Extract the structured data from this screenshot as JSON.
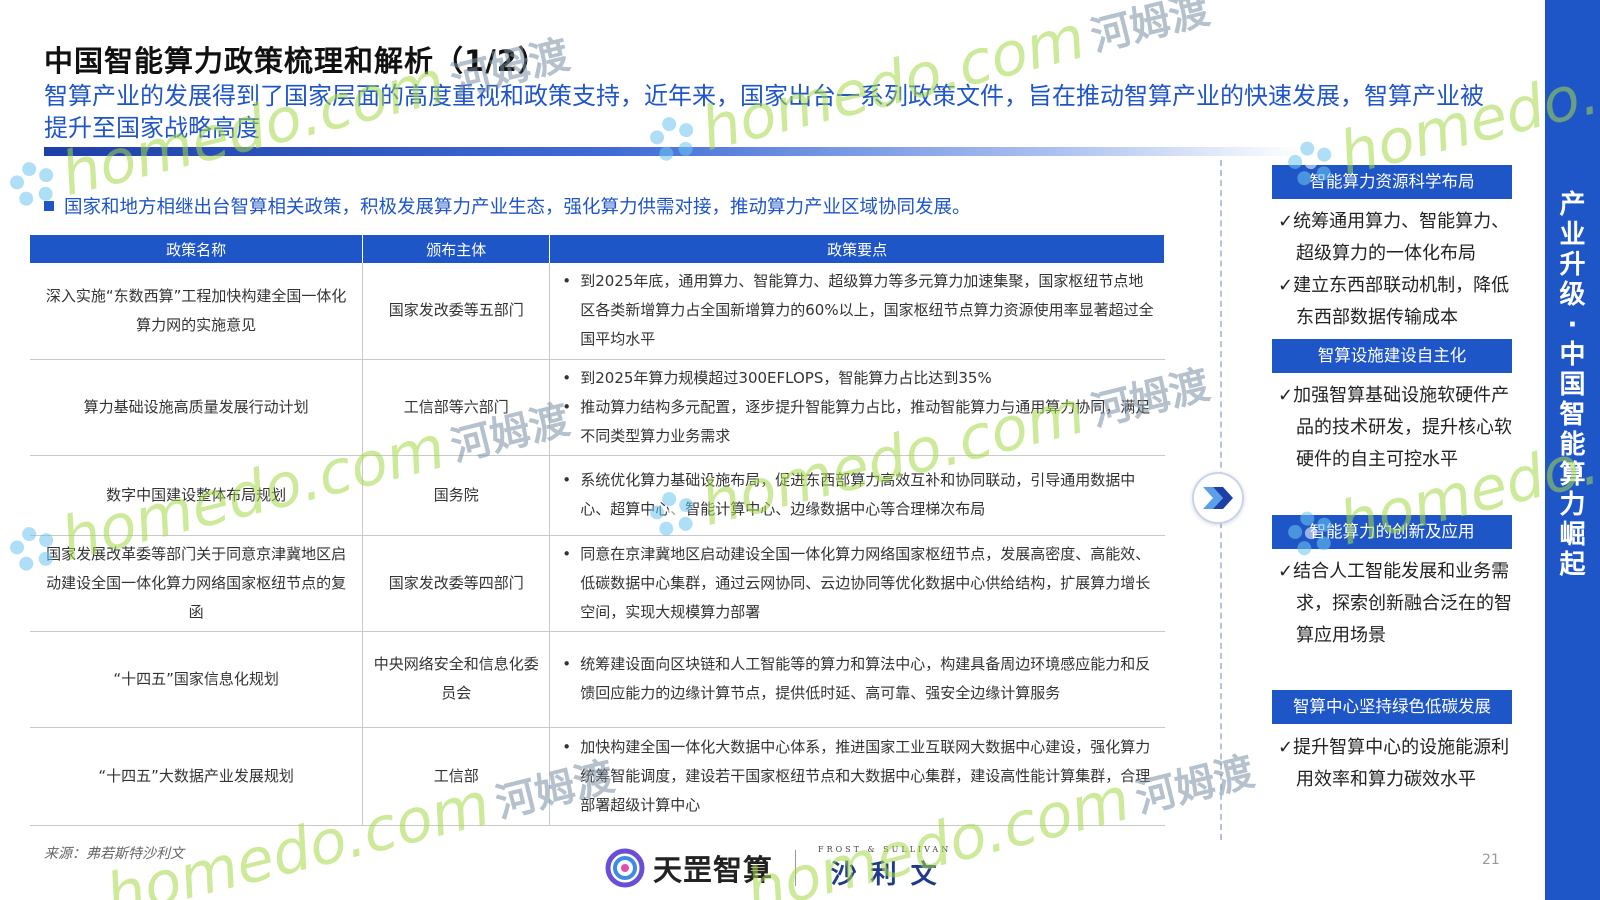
{
  "header": {
    "title": "中国智能算力政策梳理和解析（1/2）",
    "subtitle": "智算产业的发展得到了国家层面的高度重视和政策支持，近年来，国家出台一系列政策文件，旨在推动智算产业的快速发展，智算产业被提升至国家战略高度"
  },
  "intro": "国家和地方相继出台智算相关政策，积极发展算力产业生态，强化算力供需对接，推动算力产业区域协同发展。",
  "table": {
    "headers": [
      "政策名称",
      "颁布主体",
      "政策要点"
    ],
    "rows": [
      {
        "name": "深入实施“东数西算”工程加快构建全国一体化算力网的实施意见",
        "org": "国家发改委等五部门",
        "points": [
          "到2025年底，通用算力、智能算力、超级算力等多元算力加速集聚，国家枢纽节点地区各类新增算力占全国新增算力的60%以上，国家枢纽节点算力资源使用率显著超过全国平均水平"
        ]
      },
      {
        "name": "算力基础设施高质量发展行动计划",
        "org": "工信部等六部门",
        "points": [
          "到2025年算力规模超过300EFLOPS，智能算力占比达到35%",
          "推动算力结构多元配置，逐步提升智能算力占比，推动智能算力与通用算力协同，满足不同类型算力业务需求"
        ]
      },
      {
        "name": "数字中国建设整体布局规划",
        "org": "国务院",
        "points": [
          "系统优化算力基础设施布局，促进东西部算力高效互补和协同联动，引导通用数据中心、超算中心、智能计算中心、边缘数据中心等合理梯次布局"
        ]
      },
      {
        "name": "国家发展改革委等部门关于同意京津冀地区启动建设全国一体化算力网络国家枢纽节点的复函",
        "org": "国家发改委等四部门",
        "points": [
          "同意在京津冀地区启动建设全国一体化算力网络国家枢纽节点，发展高密度、高能效、低碳数据中心集群，通过云网协同、云边协同等优化数据中心供给结构，扩展算力增长空间，实现大规模算力部署"
        ]
      },
      {
        "name": "“十四五”国家信息化规划",
        "org": "中央网络安全和信息化委员会",
        "points": [
          "统筹建设面向区块链和人工智能等的算力和算法中心，构建具备周边环境感应能力和反馈回应能力的边缘计算节点，提供低时延、高可靠、强安全边缘计算服务"
        ]
      },
      {
        "name": "“十四五”大数据产业发展规划",
        "org": "工信部",
        "points": [
          "加快构建全国一体化大数据中心体系，推进国家工业互联网大数据中心建设，强化算力统筹智能调度，建设若干国家枢纽节点和大数据中心集群，建设高性能计算集群，合理部署超级计算中心"
        ]
      }
    ]
  },
  "side": {
    "sections": [
      {
        "title": "智能算力资源科学布局",
        "items": [
          "✓统筹通用算力、智能算力、超级算力的一体化布局",
          "✓建立东西部联动机制，降低东西部数据传输成本"
        ]
      },
      {
        "title": "智算设施建设自主化",
        "items": [
          "✓加强智算基础设施软硬件产品的技术研发，提升核心软硬件的自主可控水平"
        ]
      },
      {
        "title": "智能算力的创新及应用",
        "items": [
          "✓结合人工智能发展和业务需求，探索创新融合泛在的智算应用场景"
        ]
      },
      {
        "title": "智算中心坚持绿色低碳发展",
        "items": [
          "✓提升智算中心的设施能源利用效率和算力碳效水平"
        ]
      }
    ]
  },
  "rightbar": "产业升级·中国智能算力崛起",
  "footer": {
    "source": "来源：弗若斯特沙利文",
    "page": "21",
    "logo1": "天罡智算",
    "logo2_en": "FROST & SULLIVAN",
    "logo2_cn": "沙利文"
  },
  "watermark": {
    "en": "homedo.com",
    "cn": "河姆渡"
  },
  "colors": {
    "brand_blue": "#1f56c7",
    "watermark_green": "#a6d94a"
  }
}
